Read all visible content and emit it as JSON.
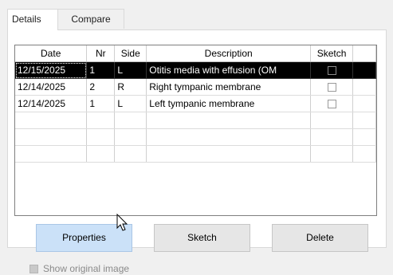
{
  "tabs": [
    {
      "label": "Details",
      "active": true
    },
    {
      "label": "Compare",
      "active": false
    }
  ],
  "grid": {
    "columns": [
      "Date",
      "Nr",
      "Side",
      "Description",
      "Sketch"
    ],
    "rows": [
      {
        "date": "12/15/2025",
        "nr": "1",
        "side": "L",
        "description": "Otitis media with effusion (OM",
        "sketch": false,
        "selected": true
      },
      {
        "date": "12/14/2025",
        "nr": "2",
        "side": "R",
        "description": "Right tympanic membrane",
        "sketch": false,
        "selected": false
      },
      {
        "date": "12/14/2025",
        "nr": "1",
        "side": "L",
        "description": "Left tympanic membrane",
        "sketch": false,
        "selected": false
      },
      {
        "date": "",
        "nr": "",
        "side": "",
        "description": "",
        "sketch": null,
        "selected": false
      },
      {
        "date": "",
        "nr": "",
        "side": "",
        "description": "",
        "sketch": null,
        "selected": false
      },
      {
        "date": "",
        "nr": "",
        "side": "",
        "description": "",
        "sketch": null,
        "selected": false
      }
    ]
  },
  "buttons": {
    "properties": "Properties",
    "sketch": "Sketch",
    "delete": "Delete"
  },
  "show_original": {
    "label": "Show original image",
    "checked": false,
    "enabled": false
  },
  "colors": {
    "selection": "#000000",
    "button_hover": "#cbe1f8"
  }
}
